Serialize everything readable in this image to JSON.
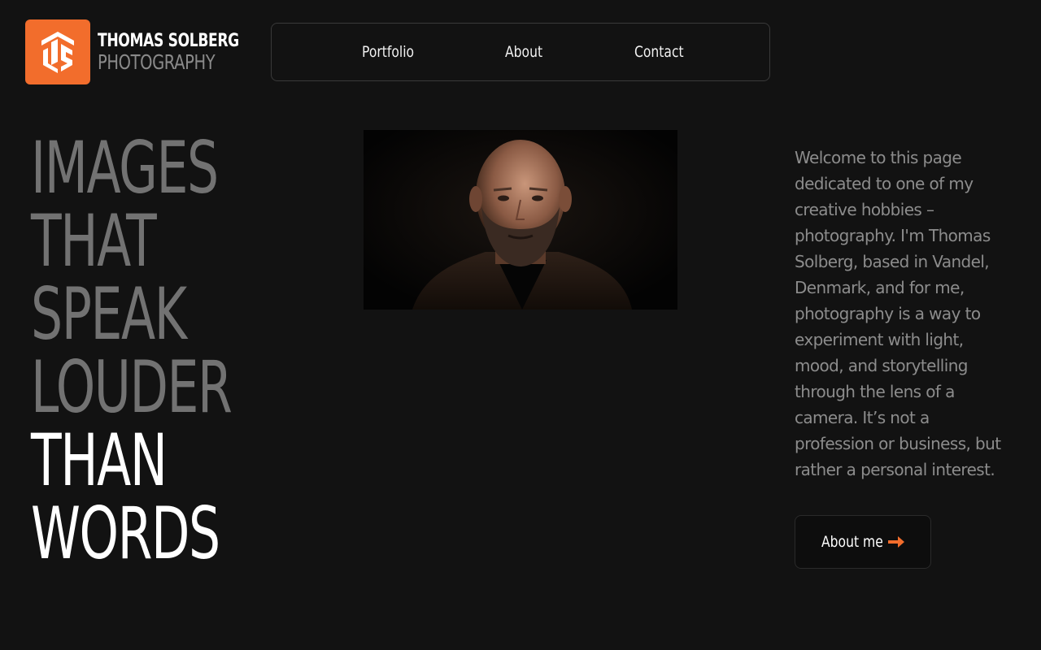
{
  "brand": {
    "name_line1": "THOMAS SOLBERG",
    "name_line2": "PHOTOGRAPHY",
    "logo_icon": "ts-monogram-icon",
    "accent_color": "#f26d2c"
  },
  "nav": {
    "items": [
      {
        "label": "Portfolio"
      },
      {
        "label": "About"
      },
      {
        "label": "Contact"
      }
    ]
  },
  "hero": {
    "headline_lines": [
      "IMAGES",
      "THAT",
      "SPEAK",
      "LOUDER",
      "THAN",
      "WORDS"
    ],
    "intro": "Welcome to this page dedicated to one of my creative hobbies – photography. I'm Thomas Solberg, based in Vandel, Denmark, and for me, photography is a way to experiment with light, mood, and storytelling through the lens of a camera. It’s not a profession or business, but rather a personal interest.",
    "cta_label": "About me",
    "cta_icon": "arrow-right-icon"
  },
  "colors": {
    "background": "#121212",
    "headline_muted": "#727272",
    "headline_highlight": "#ffffff",
    "body_text": "#8c8c8c"
  }
}
